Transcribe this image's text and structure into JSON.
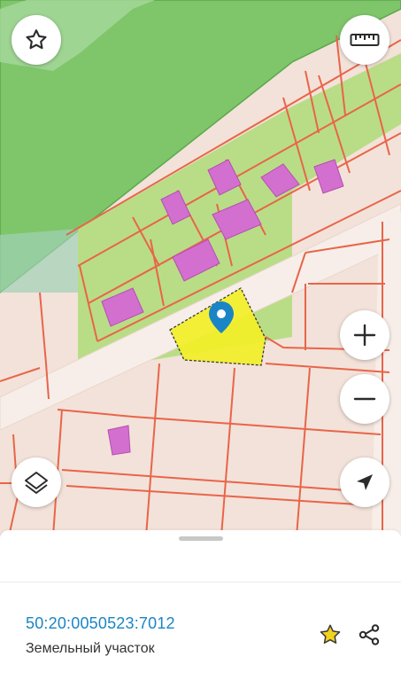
{
  "map": {
    "colors": {
      "background": "#f3e2d9",
      "forest": "#7fc56a",
      "light_green": "#b9dd86",
      "parcel_border": "#e8654a",
      "building": "#d36fcf",
      "selected_parcel": "#f2ef27",
      "marker": "#1a85c6"
    },
    "icons": {
      "favorite": "star-outline-icon",
      "ruler": "ruler-icon",
      "zoom_in": "plus-icon",
      "zoom_out": "minus-icon",
      "layers": "layers-icon",
      "locate": "location-arrow-icon",
      "marker": "map-pin-icon"
    }
  },
  "sheet": {
    "cadastral_number": "50:20:0050523:7012",
    "object_type": "Земельный участок",
    "icons": {
      "favorite": "star-icon",
      "share": "share-icon"
    },
    "colors": {
      "link": "#1a85c6",
      "star": "#f2d21a"
    }
  }
}
